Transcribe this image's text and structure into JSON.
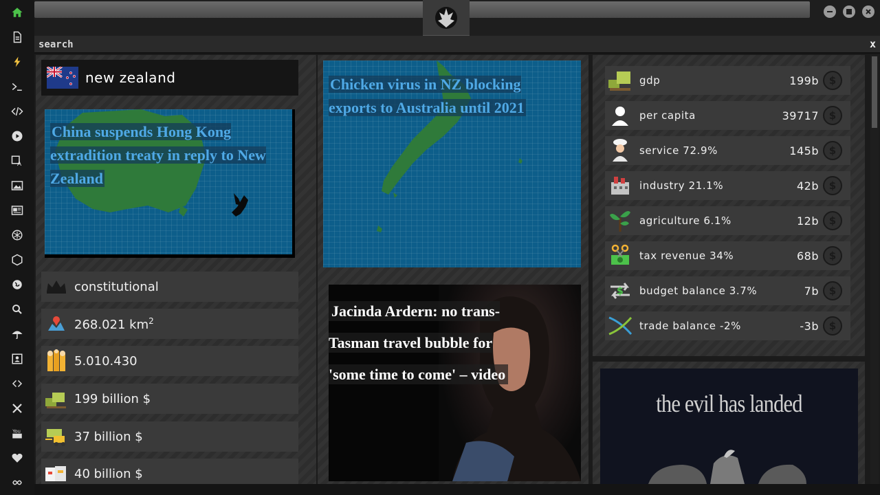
{
  "search": {
    "placeholder": "search",
    "close_label": "x"
  },
  "country": {
    "name": "new zealand"
  },
  "stats": [
    {
      "icon": "crown-icon",
      "text": "constitutional"
    },
    {
      "icon": "map-pin-icon",
      "text": "268.021 km",
      "sup": "2"
    },
    {
      "icon": "population-icon",
      "text": "5.010.430"
    },
    {
      "icon": "money-stack-icon",
      "text": "199 billion $"
    },
    {
      "icon": "forklift-money-icon",
      "text": "37 billion $"
    },
    {
      "icon": "shipping-box-icon",
      "text": "40 billion $"
    }
  ],
  "map_headlines": {
    "left": "China suspends Hong Kong extradition treaty in reply to New Zealand",
    "right": "Chicken virus in NZ blocking exports to Australia until 2021"
  },
  "news": {
    "headline": "Jacinda Ardern: no trans-Tasman travel bubble for 'some time to come' – video"
  },
  "economy": [
    {
      "icon": "money-stack-icon",
      "label": "gdp",
      "value": "199b"
    },
    {
      "icon": "person-icon",
      "label": "per capita",
      "value": "39717"
    },
    {
      "icon": "chef-icon",
      "label": "service 72.9%",
      "value": "145b"
    },
    {
      "icon": "factory-icon",
      "label": "industry 21.1%",
      "value": "42b"
    },
    {
      "icon": "plant-icon",
      "label": "agriculture 6.1%",
      "value": "12b"
    },
    {
      "icon": "scissors-money-icon",
      "label": "tax revenue 34%",
      "value": "68b"
    },
    {
      "icon": "balance-arrows-icon",
      "label": "budget balance 3.7%",
      "value": "7b"
    },
    {
      "icon": "trade-cross-icon",
      "label": "trade balance -2%",
      "value": "-3b"
    }
  ],
  "ad": {
    "text": "the evil has landed"
  },
  "currency_symbol": "$",
  "colors": {
    "accent_green": "#4cc24a",
    "map_blue": "#0d5e8a",
    "headline_blue": "#4fa9e6"
  }
}
